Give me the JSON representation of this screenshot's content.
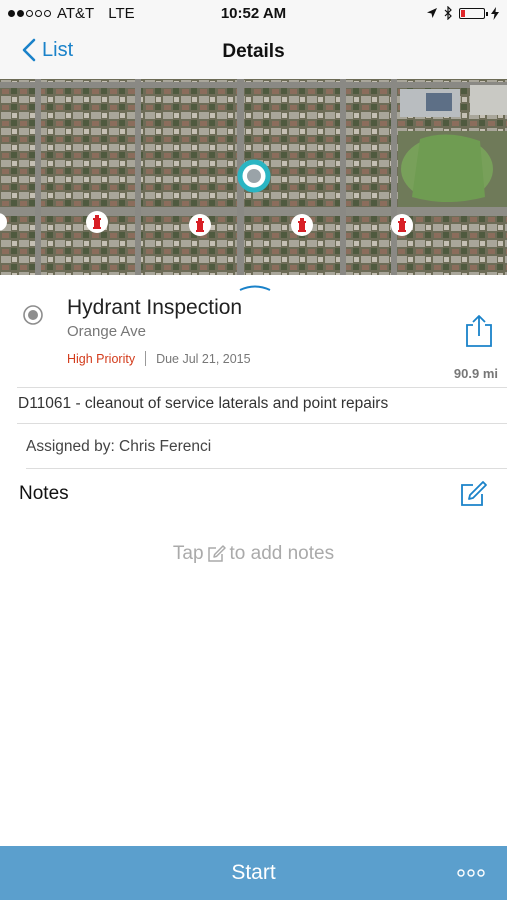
{
  "status_bar": {
    "carrier": "AT&T",
    "network": "LTE",
    "time": "10:52 AM"
  },
  "nav": {
    "back_label": "List",
    "title": "Details"
  },
  "map": {
    "selected_marker_color": "#2bb5c3",
    "hydrant_color": "#d81f26"
  },
  "work_order": {
    "title": "Hydrant Inspection",
    "location": "Orange Ave",
    "priority": "High Priority",
    "due": "Due Jul 21, 2015",
    "distance": "90.9 mi",
    "description": "D11061 - cleanout of service laterals and point repairs",
    "assigned_by": "Assigned by: Chris Ferenci"
  },
  "notes": {
    "heading": "Notes",
    "hint_prefix": "Tap",
    "hint_suffix": "to add notes"
  },
  "footer": {
    "start_label": "Start"
  },
  "colors": {
    "accent": "#1a82c9",
    "footer": "#5b9fcd",
    "priority": "#d33b1b"
  }
}
